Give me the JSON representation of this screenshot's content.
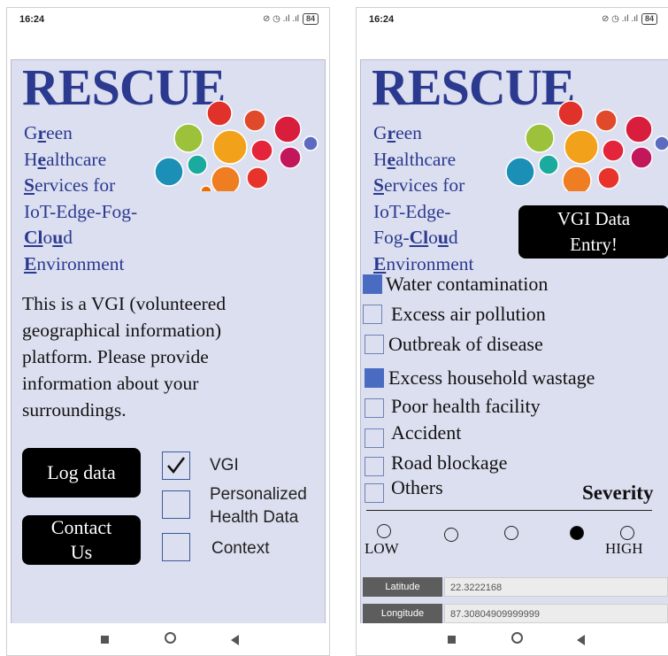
{
  "status_bar": {
    "time": "16:24",
    "icons_text": "⊘ ◷ .ıl .ıl",
    "battery": "84"
  },
  "left": {
    "title": "RESCUE",
    "acronym": [
      {
        "pre": "G",
        "key": "r",
        "post": "een"
      },
      {
        "pre": "H",
        "key": "e",
        "post": "althcare"
      },
      {
        "pre": "",
        "key": "S",
        "post": "ervices for"
      },
      {
        "pre": "",
        "key": "",
        "post": "IoT-Edge-Fog-"
      },
      {
        "pre": "",
        "key": "Cl",
        "post": "o",
        "key2": "u",
        "post2": "d"
      },
      {
        "pre": "",
        "key": "E",
        "post": "nvironment"
      }
    ],
    "intro": "This is a VGI (volunteered geographical information) platform. Please provide information about your surroundings.",
    "buttons": {
      "log_data": "Log data",
      "contact_line1": "Contact",
      "contact_line2": "Us"
    },
    "checkboxes": [
      {
        "label": "VGI",
        "checked": true
      },
      {
        "label_line1": "Personalized",
        "label_line2": "Health Data",
        "checked": false
      },
      {
        "label": "Context",
        "checked": false
      }
    ]
  },
  "right": {
    "title": "RESCUE",
    "acronym": [
      {
        "pre": "G",
        "key": "r",
        "post": "een"
      },
      {
        "pre": "H",
        "key": "e",
        "post": "althcare"
      },
      {
        "pre": "",
        "key": "S",
        "post": "ervices for"
      },
      {
        "pre": "",
        "key": "",
        "post": "IoT-Edge-"
      },
      {
        "pre": "Fog-",
        "key": "Cl",
        "post": "o",
        "key2": "u",
        "post2": "d"
      },
      {
        "pre": "",
        "key": "E",
        "post": "nvironment"
      }
    ],
    "vgi_button_line1": "VGI Data",
    "vgi_button_line2": "Entry!",
    "options": [
      {
        "label": "Water contamination",
        "checked": true
      },
      {
        "label": "Excess air pollution",
        "checked": false
      },
      {
        "label": "Outbreak of disease",
        "checked": false
      },
      {
        "label": "Excess household wastage",
        "checked": true
      },
      {
        "label": "Poor health facility",
        "checked": false
      },
      {
        "label": "Accident",
        "checked": false
      },
      {
        "label": "Road blockage",
        "checked": false
      },
      {
        "label": "Others",
        "checked": false
      }
    ],
    "severity_label": "Severity",
    "severity_low": "LOW",
    "severity_high": "HIGH",
    "severity_selected_index": 3,
    "latitude_label": "Latitude",
    "latitude_value": "22.3222168",
    "longitude_label": "Longitude",
    "longitude_value": "87.30804909999999"
  },
  "colors": {
    "title_blue": "#2b3a8f",
    "screen_bg": "#dcdff0",
    "checked_fill": "#4a6bc2"
  }
}
